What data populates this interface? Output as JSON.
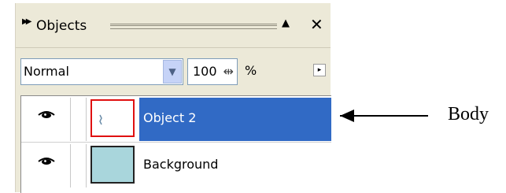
{
  "panel": {
    "title": "Objects",
    "title_icon": "double-right-arrow-icon",
    "collapse_icon": "triangle-up-icon",
    "close_icon": "close-icon"
  },
  "toolbar": {
    "blend_mode": "Normal",
    "opacity_value": "100",
    "opacity_unit": "%",
    "flyout_icon": "flyout-arrow-icon"
  },
  "objects": [
    {
      "name": "Object 2",
      "visible": true,
      "selected": true
    },
    {
      "name": "Background",
      "visible": true,
      "selected": false
    }
  ],
  "callout": {
    "label": "Body"
  }
}
